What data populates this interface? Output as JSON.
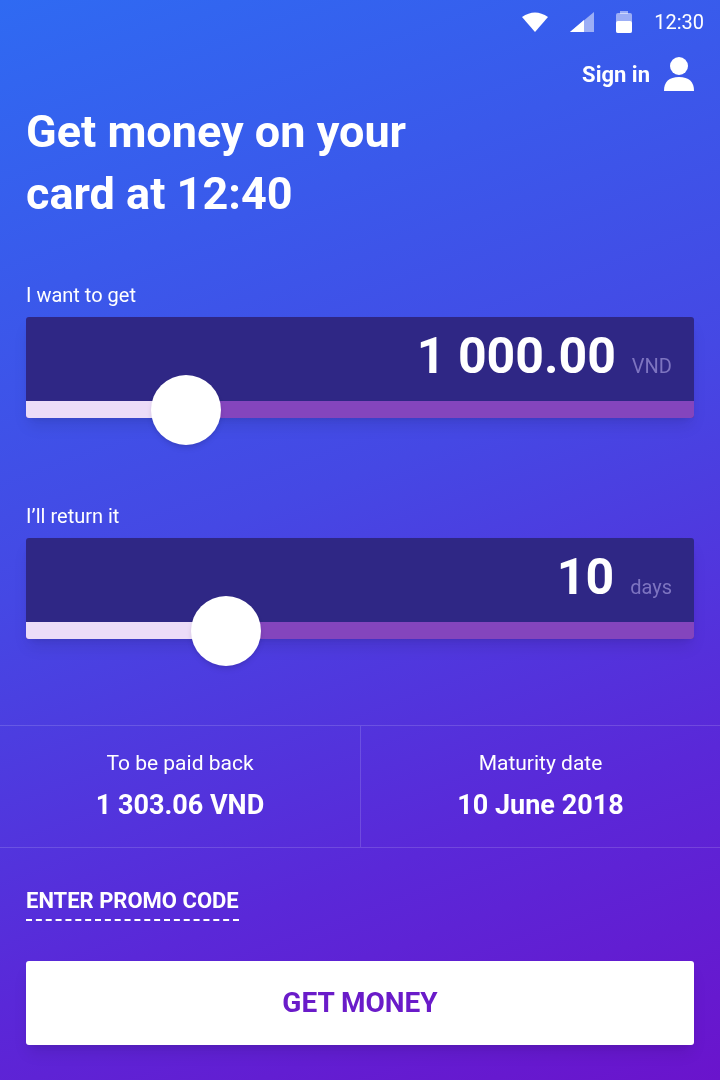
{
  "status_bar": {
    "time": "12:30"
  },
  "header": {
    "sign_in": "Sign in"
  },
  "title": "Get money on your card at 12:40",
  "sliders": [
    {
      "label": "I want to get",
      "value": "1 000.00",
      "unit": "VND",
      "level": 0.24
    },
    {
      "label": "I’ll return it",
      "value": "10",
      "unit": "days",
      "level": 0.3
    }
  ],
  "summary": [
    {
      "label": "To be paid back",
      "value": "1 303.06 VND"
    },
    {
      "label": "Maturity date",
      "value": "10 June 2018"
    }
  ],
  "promo_link": "ENTER PROMO CODE",
  "primary_button": "GET MONEY"
}
